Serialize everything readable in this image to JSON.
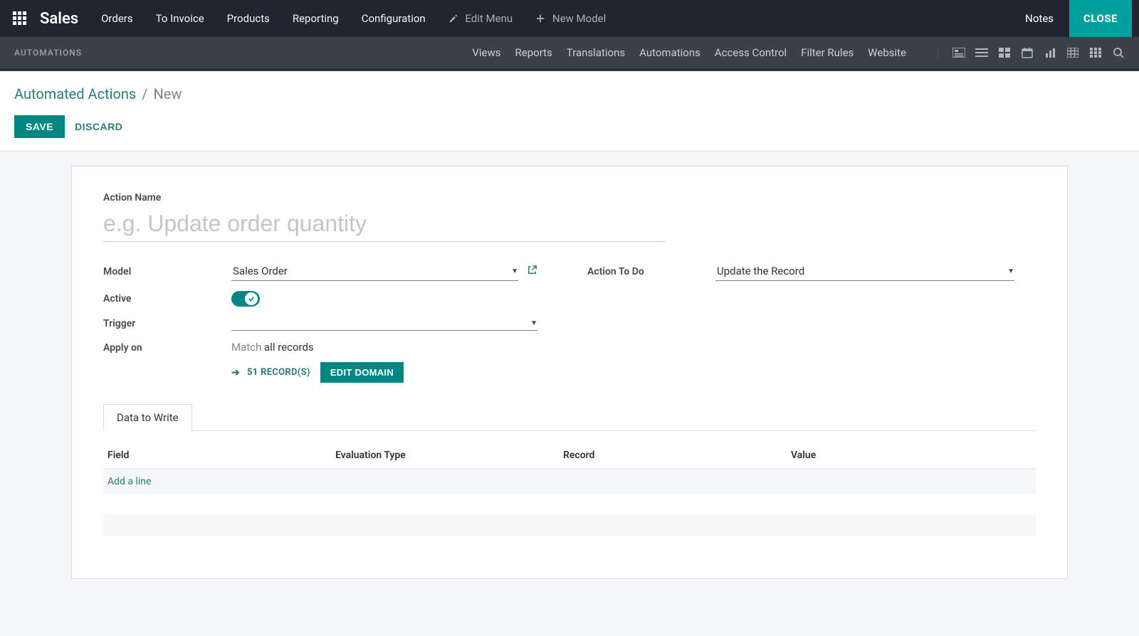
{
  "topbar": {
    "brand": "Sales",
    "nav": [
      "Orders",
      "To Invoice",
      "Products",
      "Reporting",
      "Configuration"
    ],
    "edit_menu": "Edit Menu",
    "new_model": "New Model",
    "notes": "Notes",
    "close": "CLOSE"
  },
  "secondbar": {
    "label": "AUTOMATIONS",
    "subnav": [
      "Views",
      "Reports",
      "Translations",
      "Automations",
      "Access Control",
      "Filter Rules",
      "Website"
    ]
  },
  "breadcrumb": {
    "root": "Automated Actions",
    "current": "New"
  },
  "buttons": {
    "save": "SAVE",
    "discard": "DISCARD"
  },
  "form": {
    "action_name_label": "Action Name",
    "action_name_placeholder": "e.g. Update order quantity",
    "action_name_value": "",
    "model_label": "Model",
    "model_value": "Sales Order",
    "active_label": "Active",
    "active_value": true,
    "trigger_label": "Trigger",
    "trigger_value": "",
    "applyon_label": "Apply on",
    "applyon_match_prefix": "Match",
    "applyon_match_rest": "all records",
    "records_link": "51 RECORD(S)",
    "edit_domain": "EDIT DOMAIN",
    "action_to_do_label": "Action To Do",
    "action_to_do_value": "Update the Record"
  },
  "tabs": {
    "data_to_write": "Data to Write"
  },
  "table": {
    "cols": [
      "Field",
      "Evaluation Type",
      "Record",
      "Value"
    ],
    "add_line": "Add a line"
  }
}
